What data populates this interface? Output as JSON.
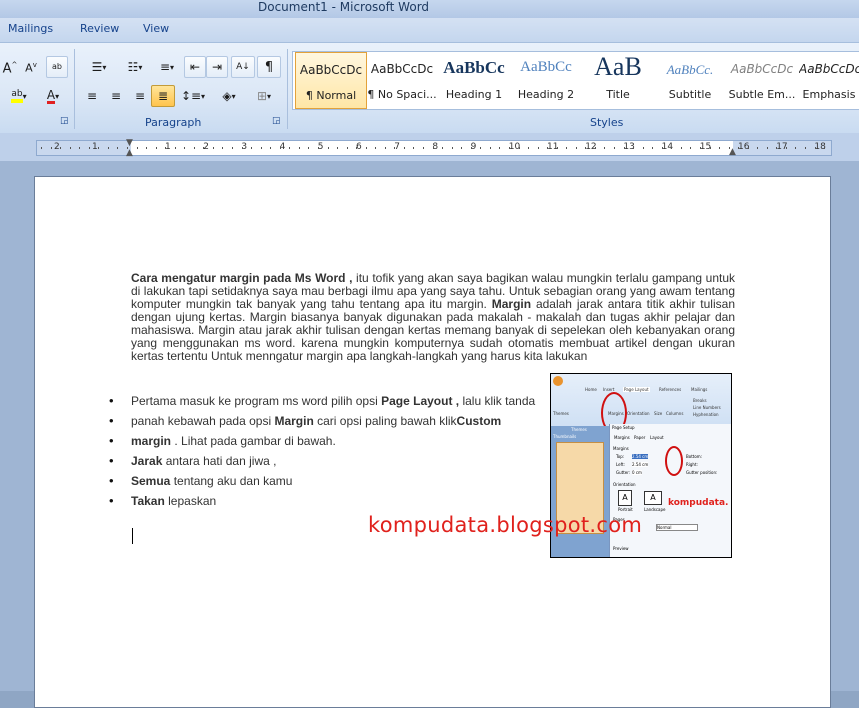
{
  "window": {
    "title": "Document1 - Microsoft Word"
  },
  "tabs": [
    {
      "label": "Mailings"
    },
    {
      "label": "Review"
    },
    {
      "label": "View"
    }
  ],
  "ribbon": {
    "groups": {
      "paragraph": "Paragraph",
      "styles": "Styles"
    },
    "style_preview": "AaBbCcDc",
    "styles": [
      {
        "preview": "AaBbCcDc",
        "name": "¶ Normal"
      },
      {
        "preview": "AaBbCcDc",
        "name": "¶ No Spaci..."
      },
      {
        "preview": "AaBbCc",
        "name": "Heading 1"
      },
      {
        "preview": "AaBbCc",
        "name": "Heading 2"
      },
      {
        "preview": "AaB",
        "name": "Title"
      },
      {
        "preview": "AaBbCc.",
        "name": "Subtitle"
      },
      {
        "preview": "AaBbCcDc",
        "name": "Subtle Em..."
      },
      {
        "preview": "AaBbCcDc",
        "name": "Emphasis"
      }
    ]
  },
  "ruler": {
    "left_numbers": [
      "2",
      "1"
    ],
    "right_numbers": [
      "1",
      "2",
      "3",
      "4",
      "5",
      "6",
      "7",
      "8",
      "9",
      "10",
      "11",
      "12",
      "13",
      "14",
      "15",
      "16",
      "17",
      "18"
    ]
  },
  "document": {
    "paragraph": {
      "bold_lead": "Cara mengatur margin pada Ms Word ,",
      "text1": " itu tofik yang akan saya bagikan walau mungkin terlalu gampang untuk di lakukan tapi setidaknya saya mau berbagi ilmu apa yang saya tahu. Untuk sebagian orang yang awam tentang komputer mungkin tak banyak yang tahu tentang apa itu margin. ",
      "bold_margin": "Margin",
      "text2": " adalah jarak antara titik akhir tulisan dengan ujung kertas. Margin biasanya banyak digunakan pada makalah - makalah dan tugas akhir pelajar dan mahasiswa. Margin atau jarak akhir tulisan dengan kertas memang banyak di sepelekan oleh kebanyakan orang yang menggunakan  ms word. karena mungkin komputernya sudah otomatis membuat artikel dengan ukuran kertas tertentu Untuk menngatur margin apa langkah-langkah yang harus kita lakukan"
    },
    "bullets": [
      {
        "a": "Pertama masuk ke program ms word  pilih opsi ",
        "b": "Page Layout ,",
        "c": " lalu klik tanda"
      },
      {
        "a": " panah kebawah pada opsi ",
        "b": "Margin",
        "c": "  cari opsi paling bawah klik",
        "d": "Custom"
      },
      {
        "a": " ",
        "b": "margin",
        "c": " . Lihat pada gambar di bawah."
      },
      {
        "a": "",
        "b": "Jarak",
        "c": " antara hati dan jiwa ,"
      },
      {
        "a": "",
        "b": "Semua",
        "c": " tentang aku dan kamu"
      },
      {
        "a": "",
        "b": "Takan",
        "c": " lepaskan"
      }
    ],
    "watermark": "kompudata.blogspot.com"
  },
  "inset": {
    "tabs": [
      "Home",
      "Insert",
      "Page Layout",
      "References",
      "Mailings"
    ],
    "dialog_title": "Page Setup",
    "dialog_tabs": [
      "Margins",
      "Paper",
      "Layout"
    ],
    "section_margins": "Margins",
    "top_label": "Top:",
    "top_value": "2.54 cm",
    "left_label": "Left:",
    "left_value": "2.54 cm",
    "gutter_label": "Gutter:",
    "gutter_value": "0 cm",
    "bottom_label": "Bottom:",
    "right_label": "Right:",
    "gutter_pos_label": "Gutter position:",
    "orientation_label": "Orientation",
    "portrait": "Portrait",
    "landscape": "Landscape",
    "pages_label": "Pages",
    "normal": "Normal",
    "preview_label": "Preview",
    "thumbnails": "Thumbnails",
    "themes": "Themes",
    "brand": "kompudata.",
    "ribbon_labels": [
      "Themes",
      "Margins",
      "Orientation",
      "Size",
      "Columns",
      "Breaks",
      "Line Numbers",
      "Hyphenation"
    ]
  },
  "colors": {
    "accent": "#15428b",
    "watermark": "#e0211c",
    "circle": "#d01010"
  }
}
